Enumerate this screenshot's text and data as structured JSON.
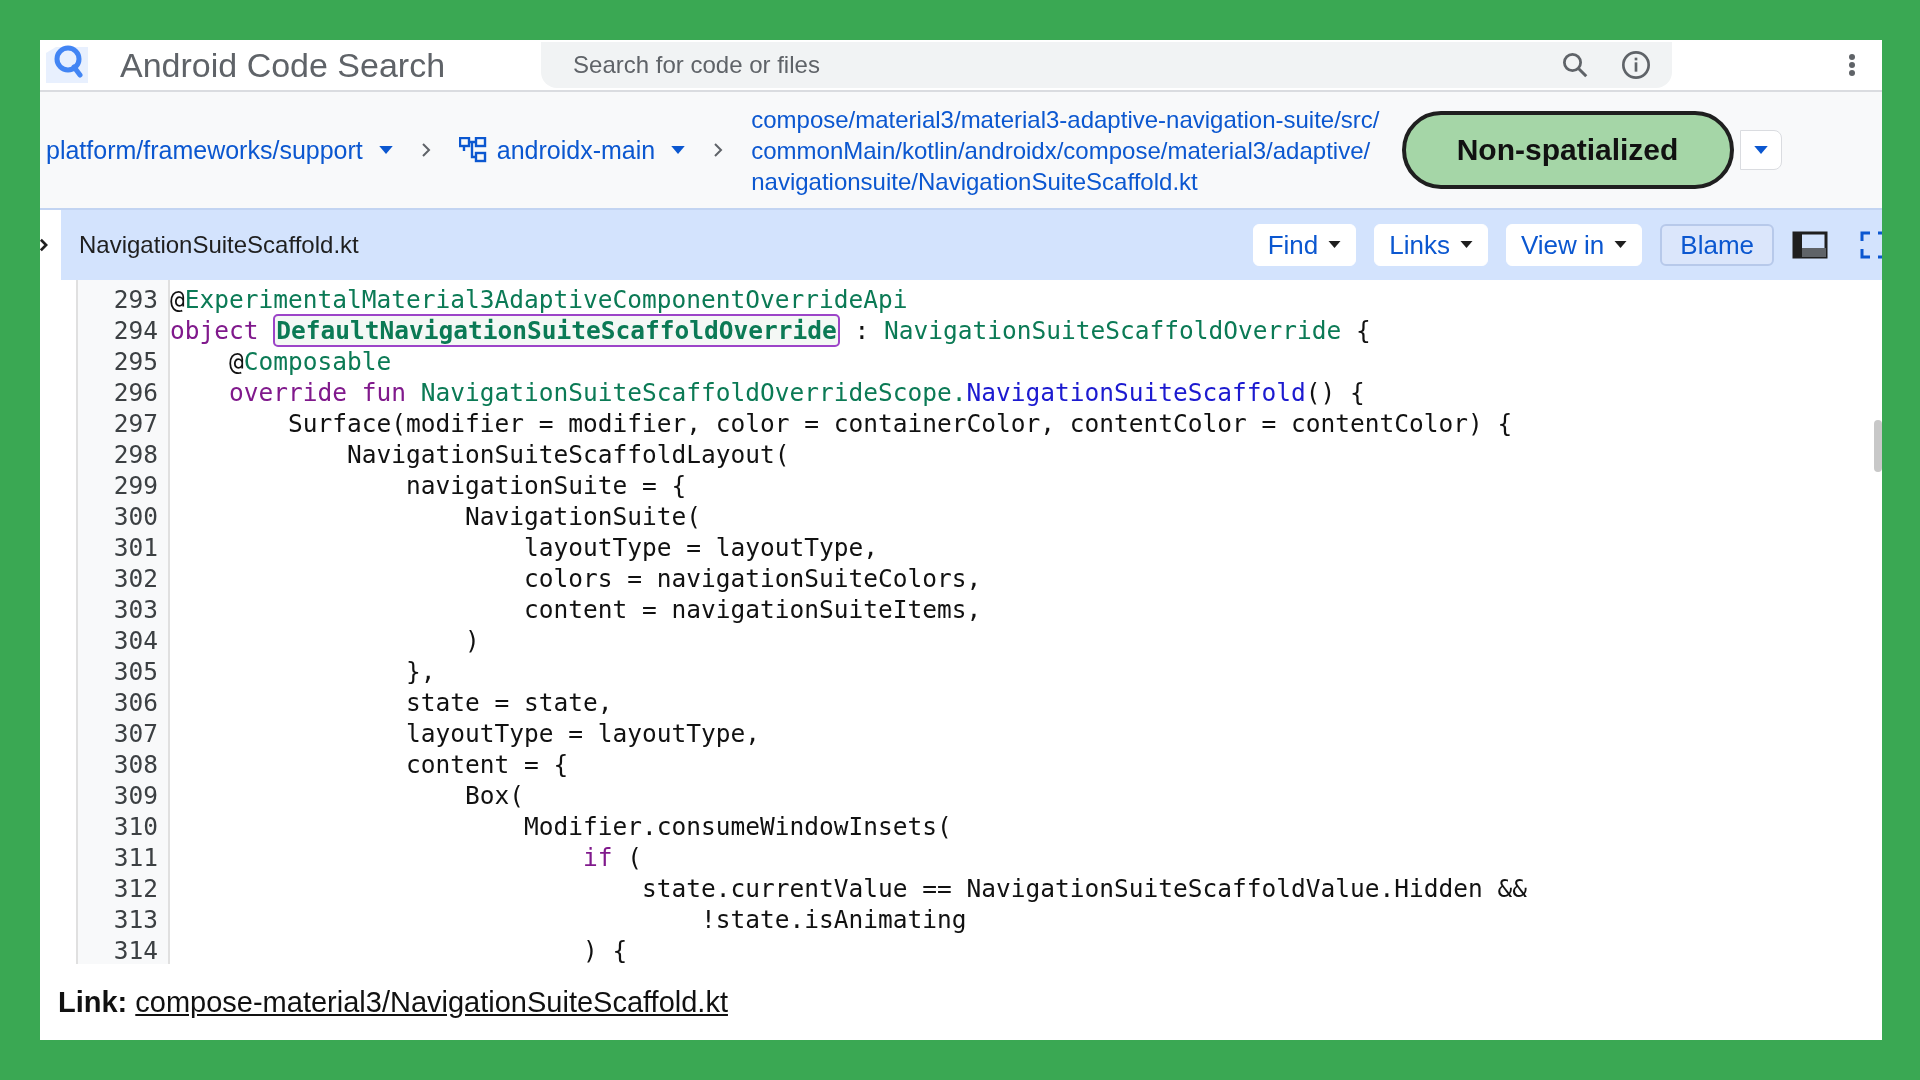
{
  "header": {
    "title": "Android Code Search",
    "search": {
      "placeholder": "Search for code or files"
    }
  },
  "breadcrumb": {
    "repo": "platform/frameworks/support",
    "branch": "androidx-main",
    "path_lines": [
      "compose/material3/material3-adaptive-navigation-suite/src/",
      "commonMain/kotlin/androidx/compose/material3/adaptive/",
      "navigationsuite/NavigationSuiteScaffold.kt"
    ]
  },
  "mode_button": {
    "label": "Non-spatialized"
  },
  "file_bar": {
    "filename": "NavigationSuiteScaffold.kt",
    "buttons": [
      {
        "label": "Find",
        "kind": "dropdown"
      },
      {
        "label": "Links",
        "kind": "dropdown"
      },
      {
        "label": "View in",
        "kind": "dropdown"
      },
      {
        "label": "Blame",
        "kind": "toggle"
      }
    ]
  },
  "code": {
    "lines": [
      {
        "number": "293",
        "tokens": [
          {
            "text": "@",
            "kind": "plain"
          },
          {
            "text": "ExperimentalMaterial3AdaptiveComponentOverrideApi",
            "kind": "type"
          }
        ]
      },
      {
        "number": "294",
        "tokens": [
          {
            "text": "object ",
            "kind": "keyword"
          },
          {
            "text": "DefaultNavigationSuiteScaffoldOverride",
            "kind": "highlight"
          },
          {
            "text": " : ",
            "kind": "plain"
          },
          {
            "text": "NavigationSuiteScaffoldOverride",
            "kind": "type"
          },
          {
            "text": " {",
            "kind": "plain"
          }
        ]
      },
      {
        "number": "295",
        "tokens": [
          {
            "text": "    @",
            "kind": "plain"
          },
          {
            "text": "Composable",
            "kind": "type"
          }
        ]
      },
      {
        "number": "296",
        "tokens": [
          {
            "text": "    override fun ",
            "kind": "keyword"
          },
          {
            "text": "NavigationSuiteScaffoldOverrideScope.",
            "kind": "type"
          },
          {
            "text": "NavigationSuiteScaffold",
            "kind": "function"
          },
          {
            "text": "() {",
            "kind": "plain"
          }
        ]
      },
      {
        "number": "297",
        "tokens": [
          {
            "text": "        Surface(modifier = modifier, color = containerColor, contentColor = contentColor) {",
            "kind": "plain"
          }
        ]
      },
      {
        "number": "298",
        "tokens": [
          {
            "text": "            NavigationSuiteScaffoldLayout(",
            "kind": "plain"
          }
        ]
      },
      {
        "number": "299",
        "tokens": [
          {
            "text": "                navigationSuite = {",
            "kind": "plain"
          }
        ]
      },
      {
        "number": "300",
        "tokens": [
          {
            "text": "                    NavigationSuite(",
            "kind": "plain"
          }
        ]
      },
      {
        "number": "301",
        "tokens": [
          {
            "text": "                        layoutType = layoutType,",
            "kind": "plain"
          }
        ]
      },
      {
        "number": "302",
        "tokens": [
          {
            "text": "                        colors = navigationSuiteColors,",
            "kind": "plain"
          }
        ]
      },
      {
        "number": "303",
        "tokens": [
          {
            "text": "                        content = navigationSuiteItems,",
            "kind": "plain"
          }
        ]
      },
      {
        "number": "304",
        "tokens": [
          {
            "text": "                    )",
            "kind": "plain"
          }
        ]
      },
      {
        "number": "305",
        "tokens": [
          {
            "text": "                },",
            "kind": "plain"
          }
        ]
      },
      {
        "number": "306",
        "tokens": [
          {
            "text": "                state = state,",
            "kind": "plain"
          }
        ]
      },
      {
        "number": "307",
        "tokens": [
          {
            "text": "                layoutType = layoutType,",
            "kind": "plain"
          }
        ]
      },
      {
        "number": "308",
        "tokens": [
          {
            "text": "                content = {",
            "kind": "plain"
          }
        ]
      },
      {
        "number": "309",
        "tokens": [
          {
            "text": "                    Box(",
            "kind": "plain"
          }
        ]
      },
      {
        "number": "310",
        "tokens": [
          {
            "text": "                        Modifier.consumeWindowInsets(",
            "kind": "plain"
          }
        ]
      },
      {
        "number": "311",
        "tokens": [
          {
            "text": "                            if",
            "kind": "keyword"
          },
          {
            "text": " (",
            "kind": "plain"
          }
        ]
      },
      {
        "number": "312",
        "tokens": [
          {
            "text": "                                state.currentValue == NavigationSuiteScaffoldValue.Hidden &&",
            "kind": "plain"
          }
        ]
      },
      {
        "number": "313",
        "tokens": [
          {
            "text": "                                    !state.isAnimating",
            "kind": "plain"
          }
        ]
      },
      {
        "number": "314",
        "tokens": [
          {
            "text": "                            ) {",
            "kind": "plain"
          }
        ]
      }
    ]
  },
  "footer": {
    "label": "Link:",
    "link": "compose-material3/NavigationSuiteScaffold.kt"
  }
}
